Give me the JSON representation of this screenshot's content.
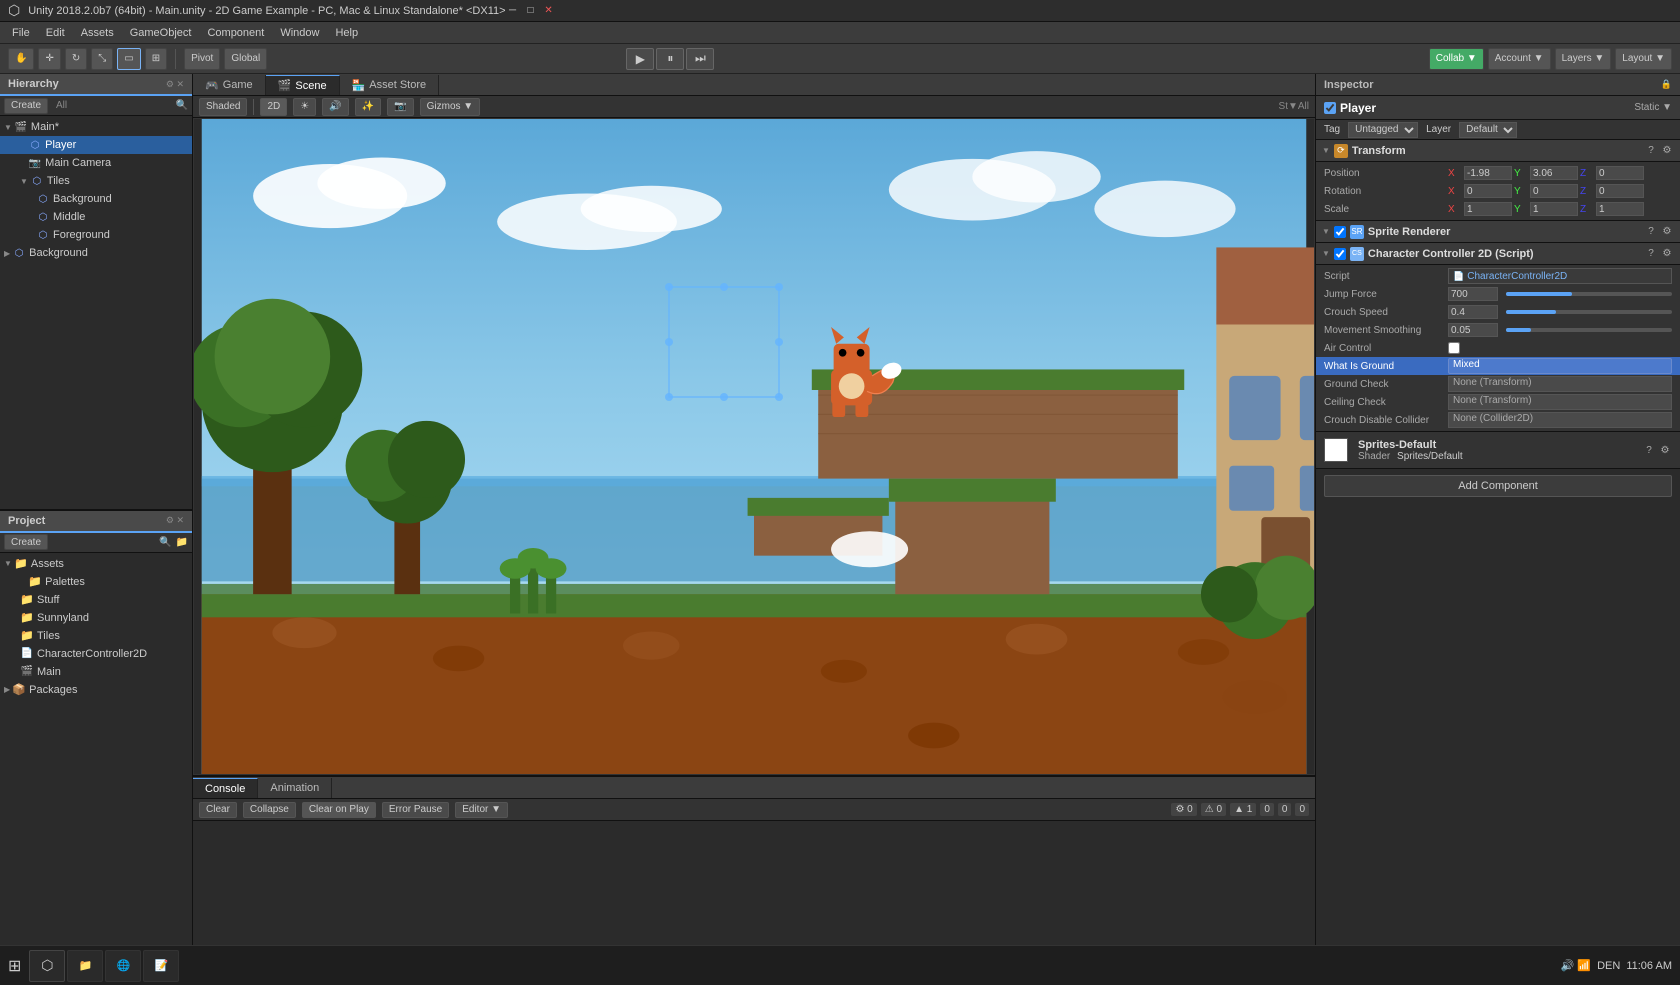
{
  "titlebar": {
    "title": "Unity 2018.2.0b7 (64bit) - Main.unity - 2D Game Example - PC, Mac & Linux Standalone* <DX11>",
    "controls": [
      "minimize",
      "maximize",
      "close"
    ]
  },
  "menubar": {
    "items": [
      "File",
      "Edit",
      "Assets",
      "GameObject",
      "Component",
      "Window",
      "Help"
    ]
  },
  "toolbar": {
    "transform_tools": [
      "hand",
      "move",
      "rotate",
      "scale",
      "rect",
      "custom"
    ],
    "pivot_label": "Pivot",
    "global_label": "Global",
    "play": "▶",
    "pause": "⏸",
    "step": "⏭",
    "collab_label": "Collab ▼",
    "account_label": "Account ▼",
    "layers_label": "Layers ▼",
    "layout_label": "Layout ▼"
  },
  "hierarchy": {
    "panel_label": "Hierarchy",
    "create_label": "Create",
    "all_label": "All",
    "items": [
      {
        "label": "Main*",
        "indent": 0,
        "arrow": "▼",
        "selected": false
      },
      {
        "label": "Player",
        "indent": 1,
        "arrow": "",
        "selected": true
      },
      {
        "label": "Main Camera",
        "indent": 1,
        "arrow": "",
        "selected": false
      },
      {
        "label": "Tiles",
        "indent": 1,
        "arrow": "▼",
        "selected": false
      },
      {
        "label": "Background",
        "indent": 2,
        "arrow": "",
        "selected": false
      },
      {
        "label": "Middle",
        "indent": 2,
        "arrow": "",
        "selected": false
      },
      {
        "label": "Foreground",
        "indent": 2,
        "arrow": "",
        "selected": false
      },
      {
        "label": "Background",
        "indent": 0,
        "arrow": "▶",
        "selected": false
      }
    ]
  },
  "scene_view": {
    "tabs": [
      {
        "label": "Game",
        "icon": "🎮",
        "active": false
      },
      {
        "label": "Scene",
        "icon": "🎬",
        "active": true
      },
      {
        "label": "Asset Store",
        "icon": "🏪",
        "active": false
      }
    ],
    "shading_mode": "Shaded",
    "view_mode": "2D",
    "gizmos_label": "Gizmos ▼",
    "stats_label": "St▼All"
  },
  "inspector": {
    "panel_label": "Inspector",
    "object_name": "Player",
    "static_label": "Static ▼",
    "tag_label": "Tag",
    "tag_value": "Untagged",
    "layer_label": "Layer",
    "layer_value": "Default",
    "components": [
      {
        "name": "Transform",
        "icon": "T",
        "enabled": true,
        "properties": [
          {
            "label": "Position",
            "x": "-1.98",
            "y": "3.06",
            "z": "0"
          },
          {
            "label": "Rotation",
            "x": "0",
            "y": "0",
            "z": "0"
          },
          {
            "label": "Scale",
            "x": "1",
            "y": "1",
            "z": "1"
          }
        ]
      },
      {
        "name": "Sprite Renderer",
        "icon": "SR",
        "enabled": true
      },
      {
        "name": "Character Controller 2D (Script)",
        "icon": "CS",
        "enabled": true,
        "script_label": "Script",
        "script_value": "CharacterController2D",
        "properties": [
          {
            "label": "Jump Force",
            "value": "700",
            "slider": true,
            "fill": 0.4
          },
          {
            "label": "Crouch Speed",
            "value": "0.4",
            "slider": true,
            "fill": 0.3
          },
          {
            "label": "Movement Smoothing",
            "value": "0.05",
            "slider": true,
            "fill": 0.15
          },
          {
            "label": "Air Control",
            "value": "",
            "checkbox": true
          },
          {
            "label": "What Is Ground",
            "value": "Mixed",
            "dropdown": true,
            "highlighted": true
          },
          {
            "label": "Ground Check",
            "value": "None (Transform)"
          },
          {
            "label": "Ceiling Check",
            "value": "None (Transform)"
          },
          {
            "label": "Crouch Disable Collider",
            "value": "None (Collider2D)"
          }
        ]
      }
    ],
    "material": {
      "name": "Sprites-Default",
      "shader_label": "Shader",
      "shader_value": "Sprites/Default"
    },
    "add_component_label": "Add Component"
  },
  "project": {
    "panel_label": "Project",
    "create_label": "Create",
    "assets_label": "Assets",
    "folders": [
      {
        "label": "Palettes",
        "indent": 1
      },
      {
        "label": "Stuff",
        "indent": 1
      },
      {
        "label": "Sunnyland",
        "indent": 1
      },
      {
        "label": "Tiles",
        "indent": 1
      },
      {
        "label": "CharacterController2D",
        "indent": 1
      },
      {
        "label": "Main",
        "indent": 1
      }
    ],
    "packages_label": "Packages"
  },
  "console": {
    "tabs": [
      "Console",
      "Animation"
    ],
    "active_tab": "Console",
    "buttons": [
      "Clear",
      "Collapse",
      "Clear on Play",
      "Error Pause",
      "Editor ▼"
    ],
    "stats": [
      "0",
      "0",
      "1",
      "0",
      "0",
      "0"
    ]
  },
  "statusbar": {
    "time": "11:06 AM"
  }
}
